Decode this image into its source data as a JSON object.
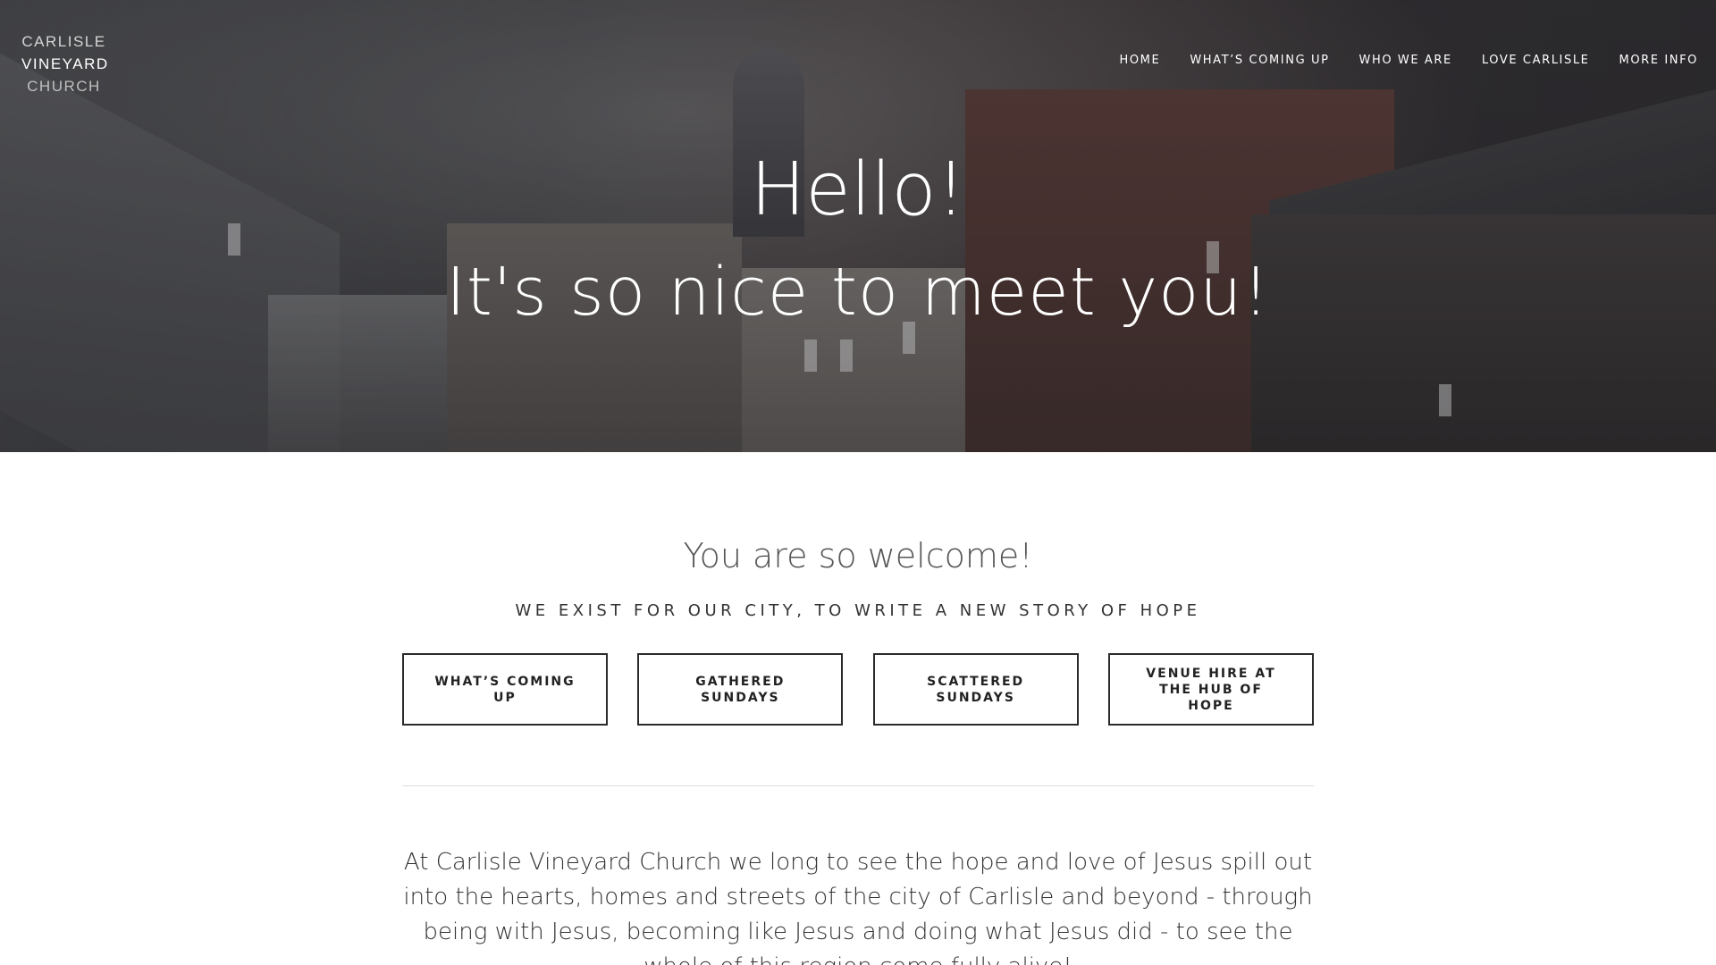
{
  "logo": {
    "line1": "CARLISLE",
    "line2": "VINEYARD",
    "line3": "CHURCH"
  },
  "nav": {
    "items": [
      {
        "label": "HOME"
      },
      {
        "label": "WHAT’S COMING UP"
      },
      {
        "label": "WHO WE ARE"
      },
      {
        "label": "LOVE CARLISLE"
      },
      {
        "label": "MORE INFO"
      }
    ]
  },
  "hero": {
    "title1": "Hello!",
    "title2": "It's so nice to meet you!"
  },
  "main": {
    "welcome": "You are so welcome!",
    "tagline": "WE EXIST FOR OUR CITY, TO WRITE A NEW STORY OF HOPE",
    "buttons": [
      {
        "label": "WHAT’S COMING UP"
      },
      {
        "label": "GATHERED SUNDAYS"
      },
      {
        "label": "SCATTERED SUNDAYS"
      },
      {
        "label": "VENUE HIRE AT THE HUB OF HOPE"
      }
    ],
    "body": "At Carlisle Vineyard Church we long to see the hope and love of Jesus spill out into the hearts, homes and streets of the city of Carlisle and beyond - through being with Jesus, becoming like Jesus and doing what Jesus did - to see the whole of this region come fully alive!"
  }
}
